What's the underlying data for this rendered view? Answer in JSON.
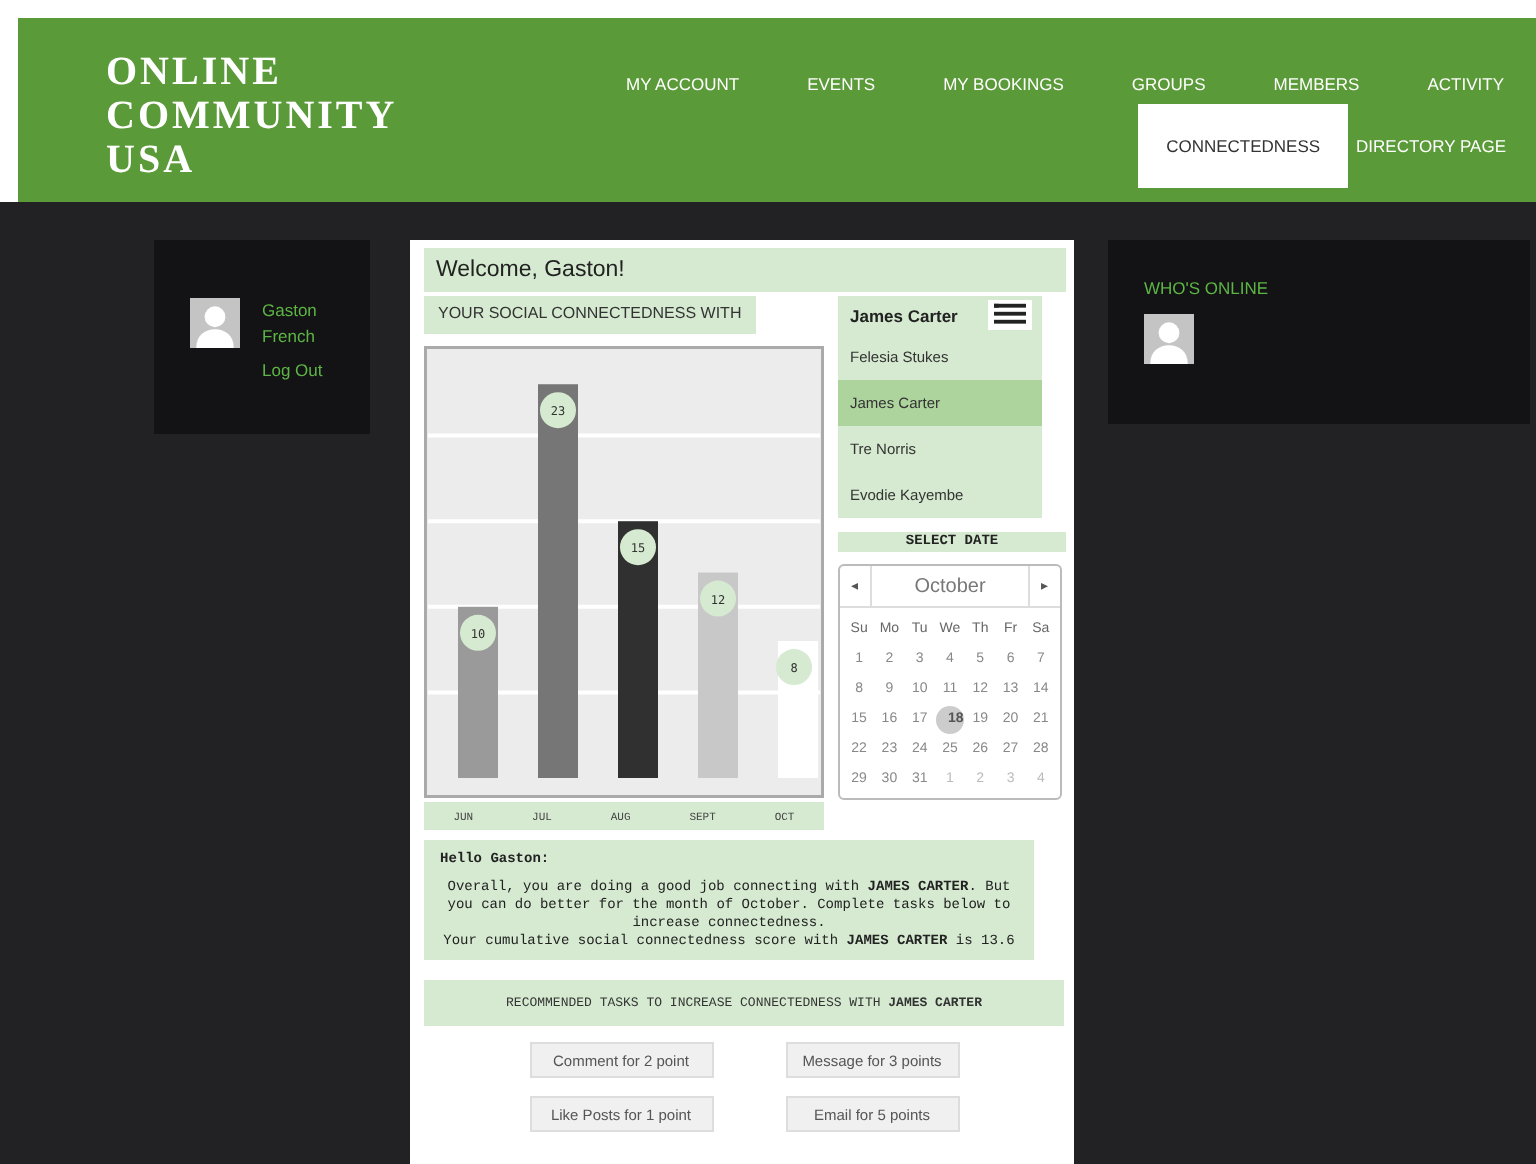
{
  "logo": [
    "ONLINE",
    "COMMUNITY",
    "USA"
  ],
  "nav_rows": [
    {
      "items": [
        {
          "label": "MY ACCOUNT",
          "selected": false
        },
        {
          "label": "EVENTS",
          "selected": false
        },
        {
          "label": "MY BOOKINGS",
          "selected": false
        },
        {
          "label": "GROUPS",
          "selected": false
        },
        {
          "label": "MEMBERS",
          "selected": false
        },
        {
          "label": "ACTIVITY",
          "selected": false
        }
      ]
    },
    {
      "items": [
        {
          "label": "CONNECTEDNESS",
          "selected": true
        },
        {
          "label": "DIRECTORY PAGE",
          "selected": false
        }
      ]
    }
  ],
  "user_panel": {
    "name": "Gaston French",
    "logout": "Log Out"
  },
  "welcome": "Welcome, Gaston!",
  "connectedness_label": "YOUR SOCIAL CONNECTEDNESS WITH",
  "person_select": {
    "value": "James Carter",
    "options": [
      {
        "label": "Felesia Stukes",
        "selected": false
      },
      {
        "label": "James Carter",
        "selected": true
      },
      {
        "label": "Tre Norris",
        "selected": false
      },
      {
        "label": "Evodie Kayembe",
        "selected": false
      }
    ]
  },
  "chart_data": {
    "type": "bar",
    "categories": [
      "JUN",
      "JUL",
      "AUG",
      "SEPT",
      "OCT"
    ],
    "values": [
      10,
      23,
      15,
      12,
      8
    ],
    "ylim": [
      0,
      25
    ],
    "data_labels": true
  },
  "select_date_label": "SELECT DATE",
  "calendar": {
    "prev": "◂",
    "next": "▸",
    "month": "October",
    "weekdays": [
      "Su",
      "Mo",
      "Tu",
      "We",
      "Th",
      "Fr",
      "Sa"
    ],
    "days": [
      {
        "d": "1",
        "selected": false,
        "outside": false
      },
      {
        "d": "2",
        "selected": false,
        "outside": false
      },
      {
        "d": "3",
        "selected": false,
        "outside": false
      },
      {
        "d": "4",
        "selected": false,
        "outside": false
      },
      {
        "d": "5",
        "selected": false,
        "outside": false
      },
      {
        "d": "6",
        "selected": false,
        "outside": false
      },
      {
        "d": "7",
        "selected": false,
        "outside": false
      },
      {
        "d": "8",
        "selected": false,
        "outside": false
      },
      {
        "d": "9",
        "selected": false,
        "outside": false
      },
      {
        "d": "10",
        "selected": false,
        "outside": false
      },
      {
        "d": "11",
        "selected": false,
        "outside": false
      },
      {
        "d": "12",
        "selected": false,
        "outside": false
      },
      {
        "d": "13",
        "selected": false,
        "outside": false
      },
      {
        "d": "14",
        "selected": false,
        "outside": false
      },
      {
        "d": "15",
        "selected": false,
        "outside": false
      },
      {
        "d": "16",
        "selected": false,
        "outside": false
      },
      {
        "d": "17",
        "selected": false,
        "outside": false
      },
      {
        "d": "18",
        "selected": true,
        "outside": false
      },
      {
        "d": "19",
        "selected": false,
        "outside": false
      },
      {
        "d": "20",
        "selected": false,
        "outside": false
      },
      {
        "d": "21",
        "selected": false,
        "outside": false
      },
      {
        "d": "22",
        "selected": false,
        "outside": false
      },
      {
        "d": "23",
        "selected": false,
        "outside": false
      },
      {
        "d": "24",
        "selected": false,
        "outside": false
      },
      {
        "d": "25",
        "selected": false,
        "outside": false
      },
      {
        "d": "26",
        "selected": false,
        "outside": false
      },
      {
        "d": "27",
        "selected": false,
        "outside": false
      },
      {
        "d": "28",
        "selected": false,
        "outside": false
      },
      {
        "d": "29",
        "selected": false,
        "outside": false
      },
      {
        "d": "30",
        "selected": false,
        "outside": false
      },
      {
        "d": "31",
        "selected": false,
        "outside": false
      },
      {
        "d": "1",
        "selected": false,
        "outside": true
      },
      {
        "d": "2",
        "selected": false,
        "outside": true
      },
      {
        "d": "3",
        "selected": false,
        "outside": true
      },
      {
        "d": "4",
        "selected": false,
        "outside": true
      }
    ]
  },
  "message": {
    "greeting": "Hello Gaston:",
    "lines": [
      "Overall, you are doing a good job connecting with **JAMES CARTER**. But you can do better for the month of October. Complete tasks below to increase connectedness.",
      "Your cumulative social connectedness score with **JAMES CARTER** is 13.6"
    ]
  },
  "tasks_title": "RECOMMENDED TASKS TO INCREASE CONNECTEDNESS WITH **JAMES CARTER**",
  "tasks": [
    "Comment for 2 point",
    "Message for 3 points",
    "Like Posts for 1 point",
    "Email for 5 points"
  ],
  "online_panel": {
    "title": "WHO'S ONLINE"
  }
}
